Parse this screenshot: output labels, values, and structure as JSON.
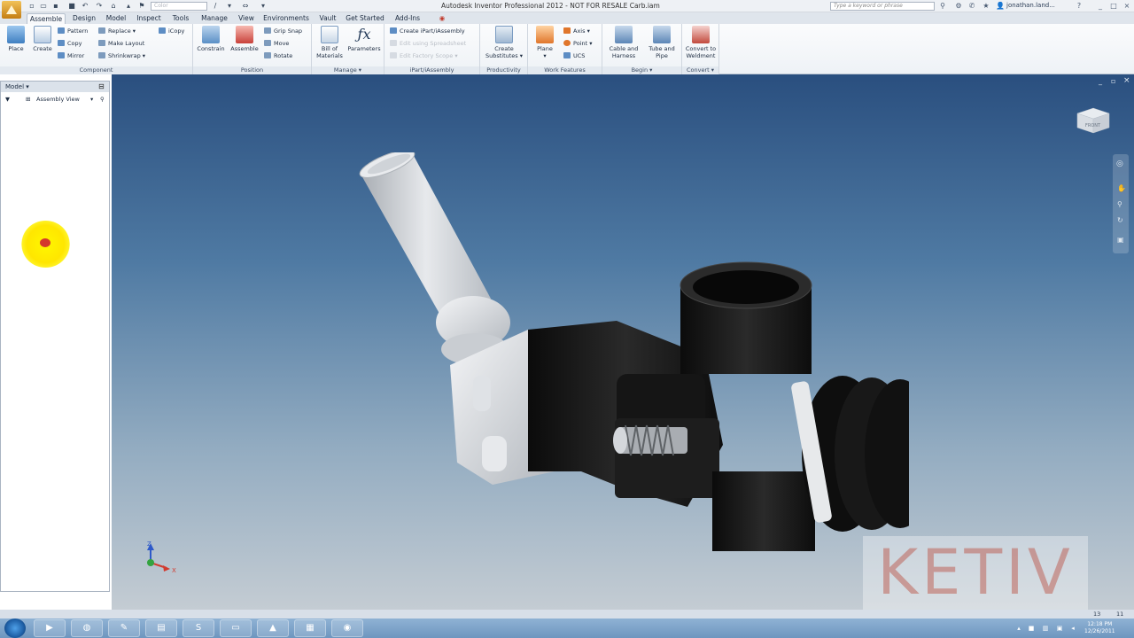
{
  "window": {
    "title": "Autodesk Inventor Professional 2012 - NOT FOR RESALE    Carb.iam",
    "search_placeholder": "Type a keyword or phrase",
    "user": "jonathan.land...",
    "color_combo": "Color"
  },
  "tabs": [
    "Assemble",
    "Design",
    "Model",
    "Inspect",
    "Tools",
    "Manage",
    "View",
    "Environments",
    "Vault",
    "Get Started",
    "Add-Ins"
  ],
  "active_tab": "Assemble",
  "ribbon": {
    "component": {
      "title": "Component",
      "place": "Place",
      "create": "Create",
      "pattern": "Pattern",
      "copy": "Copy",
      "mirror": "Mirror",
      "replace": "Replace",
      "make_layout": "Make Layout",
      "shrinkwrap": "Shrinkwrap",
      "icopy": "iCopy"
    },
    "position": {
      "title": "Position",
      "constrain": "Constrain",
      "assemble": "Assemble",
      "grip_snap": "Grip Snap",
      "move": "Move",
      "rotate": "Rotate"
    },
    "manage": {
      "title": "Manage",
      "bom_line1": "Bill of",
      "bom_line2": "Materials",
      "parameters": "Parameters"
    },
    "ipart": {
      "title": "iPart/iAssembly",
      "create": "Create iPart/iAssembly",
      "edit_spreadsheet": "Edit using Spreadsheet",
      "edit_factory": "Edit Factory Scope"
    },
    "productivity": {
      "title": "Productivity",
      "line1": "Create",
      "line2": "Substitutes"
    },
    "work_features": {
      "title": "Work Features",
      "plane": "Plane",
      "axis": "Axis",
      "point": "Point",
      "ucs": "UCS"
    },
    "begin": {
      "title": "Begin",
      "cable_line1": "Cable and",
      "cable_line2": "Harness",
      "tube_line1": "Tube and",
      "tube_line2": "Pipe"
    },
    "convert": {
      "title": "Convert",
      "line1": "Convert to",
      "line2": "Weldment"
    }
  },
  "browser": {
    "title": "Model",
    "view_mode": "Assembly View"
  },
  "viewport": {
    "viewcube_face": "FRONT",
    "axis_z": "Z",
    "axis_x": "X",
    "watermark": "KETIV"
  },
  "statusbar": {
    "count1": "13",
    "count2": "11"
  },
  "taskbar": {
    "time": "12:18 PM",
    "date": "12/26/2011"
  },
  "colors": {
    "accent": "#f2c259",
    "viewport_top": "#2a4f7f",
    "viewport_bottom": "#c4ccd3",
    "cursor_highlight": "#ffe600"
  }
}
